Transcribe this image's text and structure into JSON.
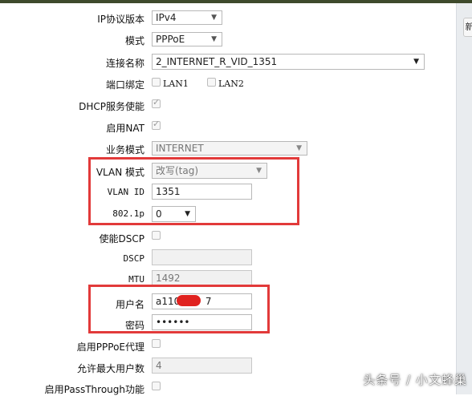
{
  "form": {
    "ip_version": {
      "label": "IP协议版本",
      "value": "IPv4"
    },
    "mode": {
      "label": "模式",
      "value": "PPPoE"
    },
    "conn_name": {
      "label": "连接名称",
      "value": "2_INTERNET_R_VID_1351"
    },
    "port_bind": {
      "label": "端口绑定",
      "lan1": "LAN1",
      "lan2": "LAN2"
    },
    "dhcp": {
      "label": "DHCP服务使能",
      "checked": true
    },
    "nat": {
      "label": "启用NAT",
      "checked": true
    },
    "service_mode": {
      "label": "业务模式",
      "value": "INTERNET"
    },
    "vlan_mode": {
      "label": "VLAN 模式",
      "value": "改写(tag)"
    },
    "vlan_id": {
      "label": "VLAN ID",
      "value": "1351"
    },
    "dot1p": {
      "label": "802.1p",
      "value": "0"
    },
    "dscp_enable": {
      "label": "使能DSCP",
      "checked": false
    },
    "dscp": {
      "label": "DSCP",
      "value": ""
    },
    "mtu": {
      "label": "MTU",
      "value": "1492"
    },
    "username": {
      "label": "用户名",
      "value_visible_start": "a1105",
      "value_visible_end": "7"
    },
    "password": {
      "label": "密码",
      "value": "••••••"
    },
    "pppoe_proxy": {
      "label": "启用PPPoE代理",
      "checked": false
    },
    "max_users": {
      "label": "允许最大用户数",
      "value": "4"
    },
    "passthrough": {
      "label": "启用PassThrough功能",
      "checked": false
    }
  },
  "sidebar": {
    "corner_text": "新"
  },
  "watermark": {
    "text": "头条号 / 小文蜂巢"
  },
  "colors": {
    "highlight": "#e23a3a",
    "redaction": "#e0221f"
  }
}
